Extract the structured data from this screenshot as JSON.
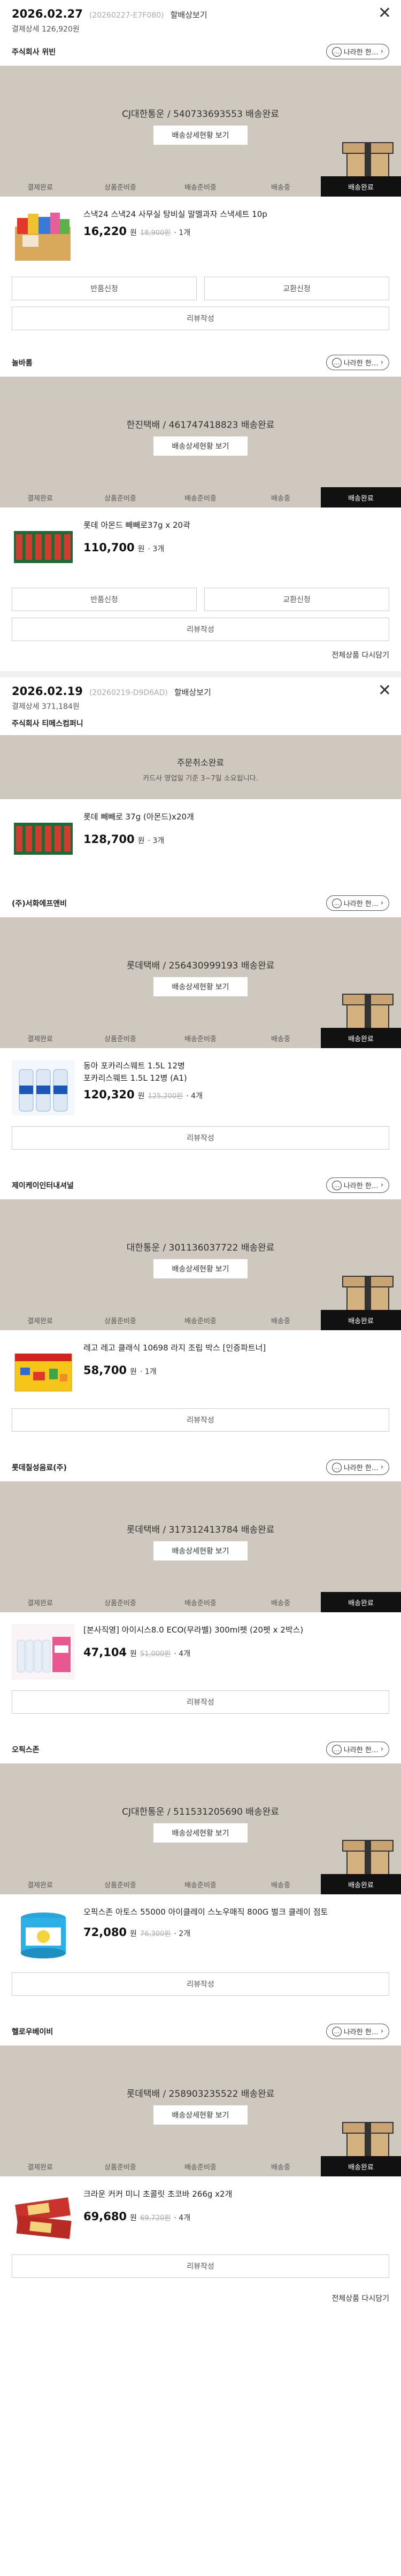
{
  "labels": {
    "detail": "할배상보기",
    "chat": "나라한 한…",
    "track": "배송상세현황 보기",
    "return": "반품신청",
    "exchange": "교환신청",
    "review": "리뷰작성",
    "retry": "전체상품 다시담기",
    "won": "원",
    "steps": [
      "결제완료",
      "상품준비중",
      "배송준비중",
      "배송중",
      "배송완료"
    ]
  },
  "orders": [
    {
      "date": "2026.02.27",
      "order_no": "(20260227-E7F080)",
      "total": "결제상세 126,920원",
      "sellers": [
        {
          "name": "주식회사 위빈",
          "carrier": "CJ대한통운 / 540733693553 배송완료",
          "product": {
            "name": "스낵24 스낵24 사무실 탕비실 말멜과자 스낵세트 10p",
            "price": "16,220",
            "orig": "18,900원",
            "qty": "· 1개"
          }
        },
        {
          "name": "놀바롬",
          "carrier": "한진택배 / 461747418823 배송완료",
          "product": {
            "name": "롯데 아몬드 빼빼로37g x 20곽",
            "price": "110,700",
            "qty": "· 3개"
          }
        }
      ]
    },
    {
      "date": "2026.02.19",
      "order_no": "(20260219-D9D6AD)",
      "total": "결제상세 371,184원",
      "sellers": [
        {
          "name": "주식회사 티메스컴퍼니",
          "cancel_title": "주문취소완료",
          "cancel_sub": "카드사 영업일 기준 3~7일 소요됩니다.",
          "product": {
            "name": "롯데 빼빼로 37g (아몬드)x20개",
            "price": "128,700",
            "qty": "· 3개"
          }
        },
        {
          "name": "(주)서화에프앤비",
          "carrier": "롯데택배 / 256430999193 배송완료",
          "product": {
            "name": "동아 포카리스웨트 1.5L 12병",
            "option": "포카리스웨트 1.5L 12병 (A1)",
            "price": "120,320",
            "orig": "125,200원",
            "qty": "· 4개"
          }
        },
        {
          "name": "제이케이인터내셔널",
          "carrier": "대한통운 / 301136037722 배송완료",
          "product": {
            "name": "레고 레고 클래식 10698 라지 조립 박스 [인증파트너]",
            "price": "58,700",
            "qty": "· 1개"
          }
        },
        {
          "name": "롯데칠성음료(주)",
          "carrier": "롯데택배 / 317312413784 배송완료",
          "product": {
            "name": "[본사직영] 아이시스8.0 ECO(무라벨) 300ml펫 (20펫 x 2박스)",
            "price": "47,104",
            "orig": "51,000원",
            "qty": "· 4개"
          }
        },
        {
          "name": "오픽스존",
          "carrier": "CJ대한통운 / 511531205690 배송완료",
          "product": {
            "name": "오픽스존 아토스 55000 아이클레이 스노우매직 800G 벌크 클레이 점토",
            "price": "72,080",
            "orig": "76,300원",
            "qty": "· 2개"
          }
        },
        {
          "name": "헬로우베이비",
          "carrier": "롯데택배 / 258903235522 배송완료",
          "product": {
            "name": "크라운 커커 미니 초콜릿 초코바 266g x2개",
            "price": "69,680",
            "orig": "69,720원",
            "qty": "· 4개"
          }
        }
      ]
    }
  ],
  "colors": {
    "status_bg": "#cfc8be",
    "active_step": "#111111"
  },
  "icons": [
    "close-icon",
    "chat-icon",
    "delivery-box-icon"
  ]
}
